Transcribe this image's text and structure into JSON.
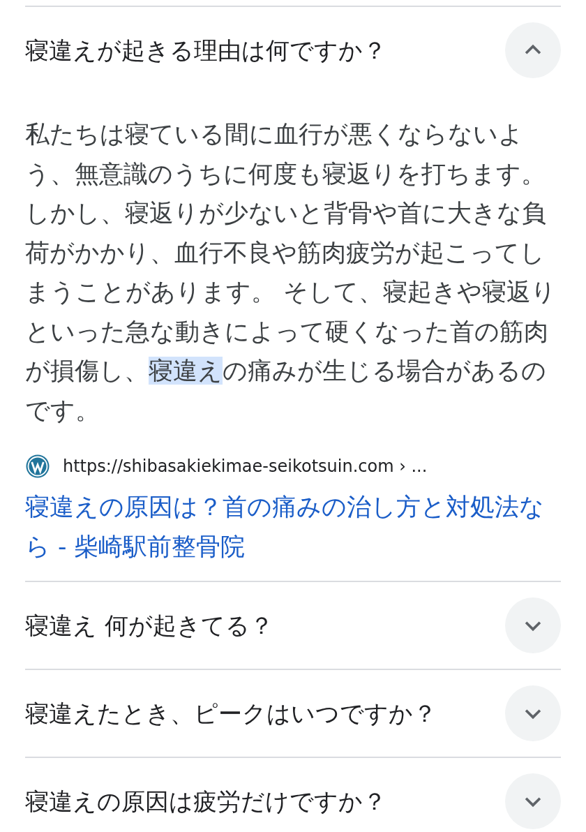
{
  "questions": [
    {
      "question": "寝違えが起きる理由は何ですか？",
      "expanded": true,
      "answer": [
        {
          "text": "私たちは寝ている間に血行が悪くならないよう、無意識のうちに何度も寝返りを打ちます。しかし、寝返りが少ないと背骨や首に大きな負荷がかかり、血行不良や筋肉疲労が起こってしまうことがあります。 そして、寝起きや寝返りといった急な動きによって硬くなった首の筋肉が損傷し、",
          "highlighted": false
        },
        {
          "text": "寝違え",
          "highlighted": true
        },
        {
          "text": "の痛みが生じる場合があるのです。",
          "highlighted": false
        }
      ],
      "source": {
        "url": "https://shibasakiekimae-seikotsuin.com › ...",
        "title": "寝違えの原因は？首の痛みの治し方と対処法なら - 柴崎駅前整骨院"
      }
    },
    {
      "question": "寝違え 何が起きてる？",
      "expanded": false
    },
    {
      "question": "寝違えたとき、ピークはいつですか？",
      "expanded": false
    },
    {
      "question": "寝違えの原因は疲労だけですか？",
      "expanded": false
    }
  ]
}
